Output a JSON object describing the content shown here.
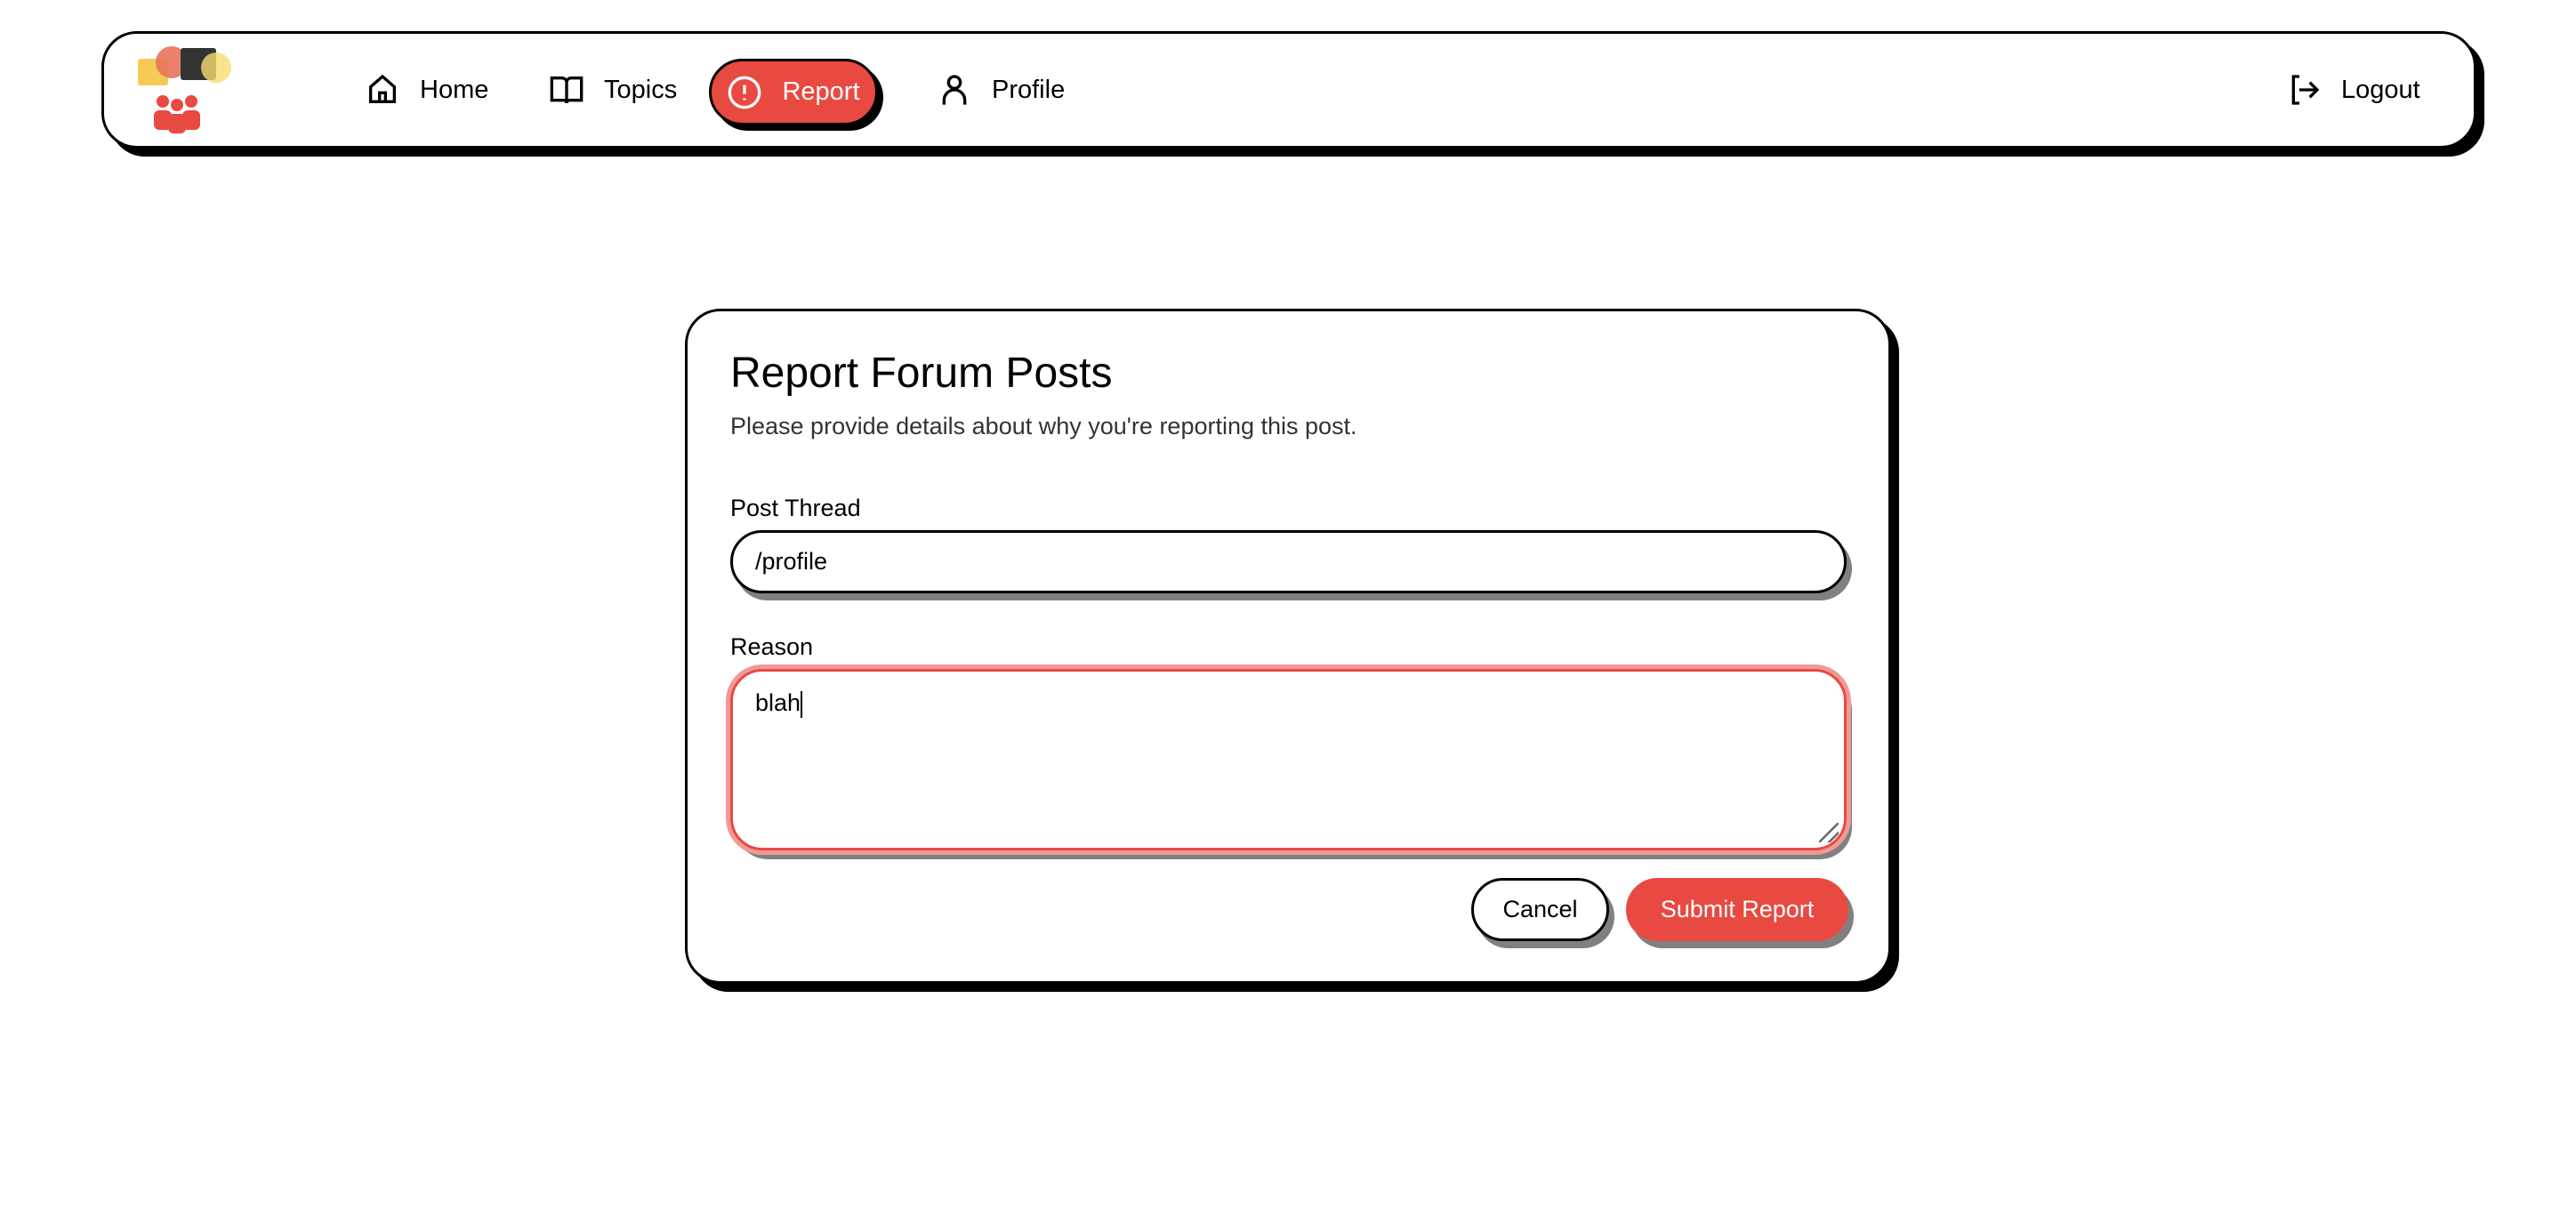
{
  "nav": {
    "items": [
      {
        "label": "Home",
        "icon": "home-icon"
      },
      {
        "label": "Topics",
        "icon": "book-icon"
      },
      {
        "label": "Report",
        "icon": "alert-circle-icon",
        "active": true
      },
      {
        "label": "Profile",
        "icon": "user-icon"
      }
    ],
    "logout": {
      "label": "Logout",
      "icon": "logout-icon"
    }
  },
  "form": {
    "title": "Report Forum Posts",
    "subtitle": "Please provide details about why you're reporting this post.",
    "post_thread_label": "Post Thread",
    "post_thread_value": "/profile",
    "reason_label": "Reason",
    "reason_value": "blah",
    "cancel_label": "Cancel",
    "submit_label": "Submit Report"
  },
  "colors": {
    "accent": "#e84a42",
    "border": "#000000",
    "shadow": "#808080"
  }
}
